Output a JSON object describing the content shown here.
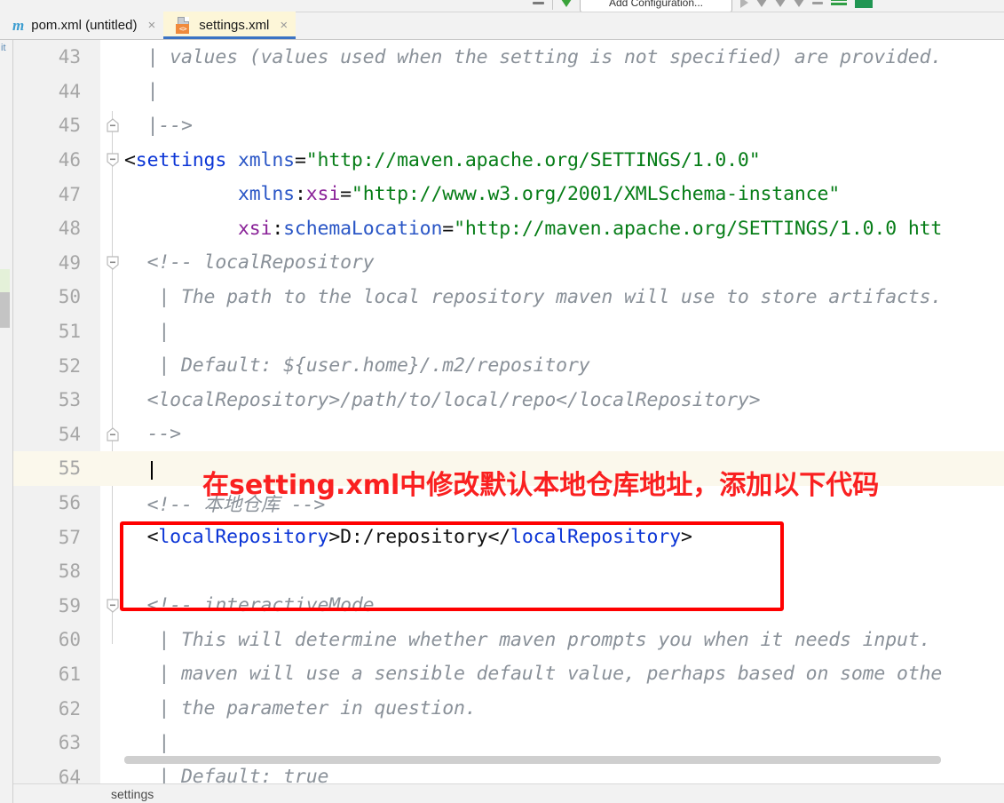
{
  "toolbar": {
    "run_config_label": "Add Configuration...",
    "icons": [
      "stop-icon",
      "run-icon",
      "debug-icon",
      "coverage-icon",
      "profile-icon",
      "build-icon",
      "search-everywhere-icon"
    ]
  },
  "tabs": [
    {
      "label": "pom.xml (untitled)",
      "icon": "maven-icon",
      "icon_glyph": "m",
      "close": "×",
      "active": false
    },
    {
      "label": "settings.xml",
      "icon": "xml-file-icon",
      "icon_glyph": "<>",
      "close": "×",
      "active": true
    }
  ],
  "left_tool_strip": {
    "label": "it"
  },
  "editor": {
    "file": "settings.xml",
    "current_line": 55,
    "caret": {
      "line": 55,
      "column": 5
    },
    "lines": [
      {
        "number": "43",
        "fold": "none",
        "segments": [
          {
            "t": "  | values (values used when the setting is not specified) are provided.",
            "c": "cmt"
          }
        ]
      },
      {
        "number": "44",
        "fold": "none",
        "segments": [
          {
            "t": "  |",
            "c": "cmt"
          }
        ]
      },
      {
        "number": "45",
        "fold": "end",
        "segments": [
          {
            "t": "  |-->",
            "c": "cmt"
          }
        ]
      },
      {
        "number": "46",
        "fold": "start",
        "segments": [
          {
            "t": "<",
            "c": "punct"
          },
          {
            "t": "settings",
            "c": "tag"
          },
          {
            "t": " ",
            "c": "txt"
          },
          {
            "t": "xmlns",
            "c": "attr"
          },
          {
            "t": "=",
            "c": "punct"
          },
          {
            "t": "\"http://maven.apache.org/SETTINGS/1.0.0\"",
            "c": "str"
          }
        ]
      },
      {
        "number": "47",
        "fold": "none",
        "segments": [
          {
            "t": "          ",
            "c": "txt"
          },
          {
            "t": "xmlns",
            "c": "attr"
          },
          {
            "t": ":",
            "c": "punct"
          },
          {
            "t": "xsi",
            "c": "attr2"
          },
          {
            "t": "=",
            "c": "punct"
          },
          {
            "t": "\"http://www.w3.org/2001/XMLSchema-instance\"",
            "c": "str"
          }
        ]
      },
      {
        "number": "48",
        "fold": "none",
        "segments": [
          {
            "t": "          ",
            "c": "txt"
          },
          {
            "t": "xsi",
            "c": "attr2"
          },
          {
            "t": ":",
            "c": "punct"
          },
          {
            "t": "schemaLocation",
            "c": "attr"
          },
          {
            "t": "=",
            "c": "punct"
          },
          {
            "t": "\"http://maven.apache.org/SETTINGS/1.0.0 htt",
            "c": "str"
          }
        ]
      },
      {
        "number": "49",
        "fold": "start",
        "segments": [
          {
            "t": "  <!-- localRepository",
            "c": "cmt"
          }
        ]
      },
      {
        "number": "50",
        "fold": "none",
        "segments": [
          {
            "t": "   | The path to the local repository maven will use to store artifacts.",
            "c": "cmt"
          }
        ]
      },
      {
        "number": "51",
        "fold": "none",
        "segments": [
          {
            "t": "   |",
            "c": "cmt"
          }
        ]
      },
      {
        "number": "52",
        "fold": "none",
        "segments": [
          {
            "t": "   | Default: ${user.home}/.m2/repository",
            "c": "cmt"
          }
        ]
      },
      {
        "number": "53",
        "fold": "none",
        "segments": [
          {
            "t": "  <localRepository>/path/to/local/repo</localRepository>",
            "c": "cmt"
          }
        ]
      },
      {
        "number": "54",
        "fold": "end",
        "segments": [
          {
            "t": "  -->",
            "c": "cmt"
          }
        ]
      },
      {
        "number": "55",
        "fold": "none",
        "current": true,
        "segments": [
          {
            "t": "    ",
            "c": "txt"
          }
        ]
      },
      {
        "number": "56",
        "fold": "none",
        "segments": [
          {
            "t": "  <!-- 本地仓库 -->",
            "c": "cmt"
          }
        ]
      },
      {
        "number": "57",
        "fold": "none",
        "segments": [
          {
            "t": "  <",
            "c": "punct"
          },
          {
            "t": "localRepository",
            "c": "tag"
          },
          {
            "t": ">",
            "c": "punct"
          },
          {
            "t": "D:/repository",
            "c": "txt"
          },
          {
            "t": "</",
            "c": "punct"
          },
          {
            "t": "localRepository",
            "c": "tag"
          },
          {
            "t": ">",
            "c": "punct"
          }
        ]
      },
      {
        "number": "58",
        "fold": "none",
        "segments": [
          {
            "t": "",
            "c": "txt"
          }
        ]
      },
      {
        "number": "59",
        "fold": "start",
        "segments": [
          {
            "t": "  <!-- interactiveMode",
            "c": "cmt"
          }
        ]
      },
      {
        "number": "60",
        "fold": "none",
        "segments": [
          {
            "t": "   | This will determine whether maven prompts you when it needs input.",
            "c": "cmt"
          }
        ]
      },
      {
        "number": "61",
        "fold": "none",
        "segments": [
          {
            "t": "   | maven will use a sensible default value, perhaps based on some othe",
            "c": "cmt"
          }
        ]
      },
      {
        "number": "62",
        "fold": "none",
        "segments": [
          {
            "t": "   | the parameter in question.",
            "c": "cmt"
          }
        ]
      },
      {
        "number": "63",
        "fold": "none",
        "segments": [
          {
            "t": "   |",
            "c": "cmt"
          }
        ]
      },
      {
        "number": "64",
        "fold": "none",
        "segments": [
          {
            "t": "   | Default: true",
            "c": "cmt"
          }
        ]
      }
    ]
  },
  "annotation": {
    "text": "在setting.xml中修改默认本地仓库地址，添加以下代码",
    "color": "#fa2020"
  },
  "highlight_box": {
    "color": "#ff0000"
  },
  "breadcrumb": {
    "path": "settings"
  },
  "colors": {
    "tag": "#0b35d6",
    "attribute": "#2a56c6",
    "attribute_ns": "#8a2398",
    "string": "#067d17",
    "comment": "#8a9199",
    "current_line_bg": "#fbf8ec",
    "active_tab_bg": "#fdf6d8",
    "tab_underline": "#3b73c4"
  }
}
